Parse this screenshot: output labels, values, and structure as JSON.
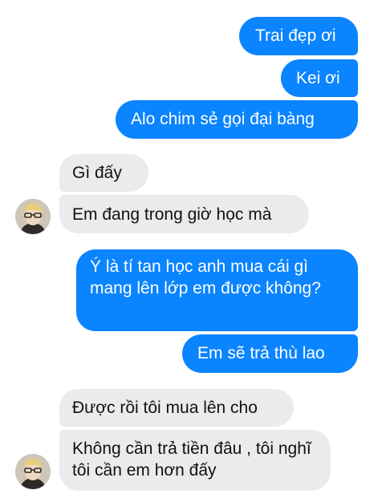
{
  "chat": {
    "messages": [
      {
        "sender": "me",
        "text": "Trai đẹp ơi"
      },
      {
        "sender": "me",
        "text": "Kei ơi"
      },
      {
        "sender": "me",
        "text": "Alo  chim sẻ gọi đại bàng"
      },
      {
        "sender": "other",
        "text": "Gì đấy"
      },
      {
        "sender": "other",
        "text": "Em đang trong giờ học mà"
      },
      {
        "sender": "me",
        "text": "Ý là tí tan học anh mua cái gì mang lên lớp em được không?"
      },
      {
        "sender": "me",
        "text": "Em sẽ trả thù lao"
      },
      {
        "sender": "other",
        "text": "Được rồi tôi mua lên cho"
      },
      {
        "sender": "other",
        "text": "Không cần trả tiền đâu , tôi nghĩ tôi cần em hơn đấy"
      }
    ]
  },
  "colors": {
    "sent_bubble": "#0b84ff",
    "received_bubble": "#ebebeb",
    "sent_text": "#ffffff",
    "received_text": "#111111"
  },
  "icons": {
    "avatar": "contact-avatar"
  }
}
